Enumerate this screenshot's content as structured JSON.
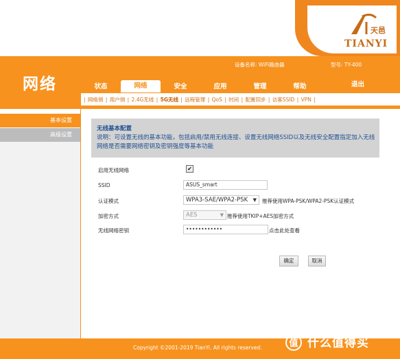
{
  "brand": {
    "logo_top": "天邑",
    "logo_name": "TIANYI"
  },
  "header": {
    "section_title": "网络",
    "device_name": "设备名称: WiFi路由器",
    "model": "型号: TY-400",
    "logout": "退出",
    "tabs": [
      {
        "label": "状态",
        "active": false
      },
      {
        "label": "网络",
        "active": true
      },
      {
        "label": "安全",
        "active": false
      },
      {
        "label": "应用",
        "active": false
      },
      {
        "label": "管理",
        "active": false
      },
      {
        "label": "帮助",
        "active": false
      }
    ]
  },
  "subnav": {
    "items": [
      "网络侧",
      "用户侧",
      "2.4G无线",
      "5G无线",
      "远程管理",
      "QoS",
      "时间",
      "配置同步",
      "访客SSID",
      "VPN"
    ],
    "active": "5G无线"
  },
  "sidebar": {
    "basic": "基本设置",
    "advanced": "高级设置"
  },
  "info": {
    "title": "无线基本配置",
    "text": "说明：可设置无线的基本功能，包括启用/禁用无线连接、设置无线网络SSID以及无线安全配置指定加入无线网络是否需要网络密钥及密钥强度等基本功能"
  },
  "form": {
    "enable_label": "启用无线网络",
    "enable_checked": true,
    "ssid_label": "SSID",
    "ssid_value": "ASUS_smart",
    "auth_label": "认证模式",
    "auth_value": "WPA3-SAE/WPA2-PSK",
    "auth_hint": "推荐使用WPA-PSK/WPA2-PSK认证模式",
    "enc_label": "加密方式",
    "enc_value": "AES",
    "enc_hint": "推荐使用TKIP+AES加密方式",
    "key_label": "无线网络密钥",
    "key_value": "••••••••••••",
    "key_hint": "点击此处查看"
  },
  "buttons": {
    "ok": "确定",
    "cancel": "取消"
  },
  "footer": {
    "copyright": "Copyright ©2001-2019 TianYi. All rights reserved.",
    "watermark": "什么值得买"
  },
  "colors": {
    "orange": "#f7921e",
    "info_text": "#1f4e8f",
    "sidebar_gray": "#bcbcbc"
  }
}
